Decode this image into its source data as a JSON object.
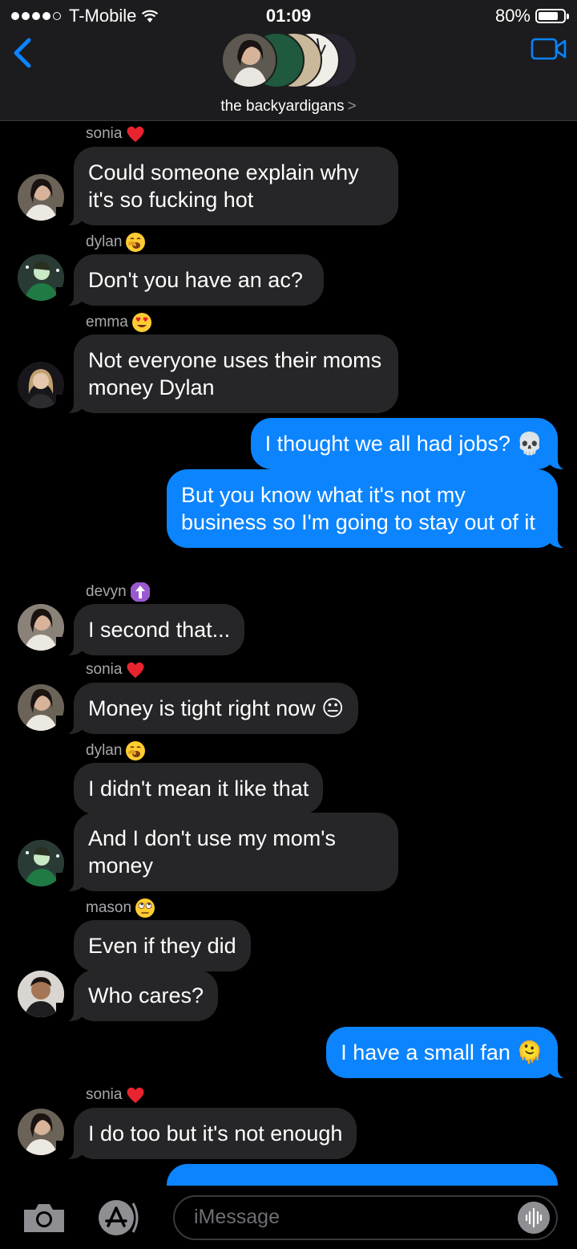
{
  "status": {
    "carrier": "T-Mobile",
    "time": "01:09",
    "battery": "80%",
    "battery_level": 0.8
  },
  "header": {
    "group_name": "the backyardigans",
    "chevron": ">"
  },
  "messages": [
    {
      "sender": "sonia",
      "sender_emoji": "red-heart",
      "text": "Could someone explain why it's so fucking hot",
      "direction": "in"
    },
    {
      "sender": "dylan",
      "sender_emoji": "yawning-face",
      "text": "Don't you have an ac?",
      "direction": "in"
    },
    {
      "sender": "emma",
      "sender_emoji": "heart-eyes-face",
      "text": "Not everyone uses their moms money Dylan",
      "direction": "in"
    },
    {
      "text": "I thought we all had jobs? 💀",
      "direction": "out"
    },
    {
      "text": "But you know what it's not my business so I'm going to stay out of it",
      "direction": "out"
    },
    {
      "sender": "devyn",
      "sender_emoji": "up-arrow-box",
      "text": "I second that...",
      "direction": "in"
    },
    {
      "sender": "sonia",
      "sender_emoji": "red-heart",
      "text": "Money is tight right now 😐",
      "direction": "in"
    },
    {
      "sender": "dylan",
      "sender_emoji": "yawning-face",
      "text": "I didn't mean it like that",
      "direction": "in"
    },
    {
      "text": "And I don't use my mom's money",
      "direction": "in"
    },
    {
      "sender": "mason",
      "sender_emoji": "eye-roll-face",
      "text": "Even if they did",
      "direction": "in"
    },
    {
      "text": "Who cares?",
      "direction": "in"
    },
    {
      "text": "I have a small fan 🫠",
      "direction": "out"
    },
    {
      "sender": "sonia",
      "sender_emoji": "red-heart",
      "text": "I do too but it's not enough",
      "direction": "in"
    }
  ],
  "input": {
    "placeholder": "iMessage"
  },
  "colors": {
    "background": "#000000",
    "bar": "#1c1c1e",
    "incoming": "#262628",
    "outgoing": "#0b84fe",
    "accent": "#0a84ff"
  }
}
